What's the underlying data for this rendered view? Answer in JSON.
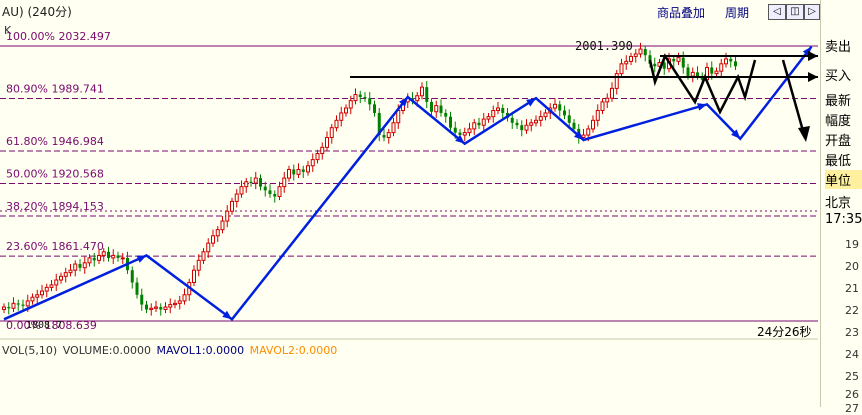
{
  "header": {
    "title": "AU)  (240分)",
    "subtitle": "K",
    "overlay_label": "商品叠加",
    "period_label": "周期"
  },
  "side": {
    "items": [
      "卖出",
      "买入",
      "最新",
      "幅度",
      "开盘",
      "最低",
      "单位",
      "北京",
      "17:35"
    ],
    "ticks": [
      "19",
      "20",
      "21",
      "22",
      "23",
      "24",
      "25",
      "26",
      "27"
    ]
  },
  "timer": "24分26秒",
  "volume": {
    "label": "VOL(5,10)",
    "volume": "VOLUME:0.0000",
    "mavol1": "MAVOL1:0.0000",
    "mavol2": "MAVOL2:0.0000",
    "mavol1_color": "#000080",
    "mavol2_color": "#ff8c00"
  },
  "chart_data": {
    "type": "candlestick",
    "high_annotation": "2001.390",
    "low_annotation": "1808.7",
    "fib_levels": [
      {
        "label": "100.00% 2032.497",
        "pct": 100.0,
        "price": 2032.497
      },
      {
        "label": "80.90% 1989.741",
        "pct": 80.9,
        "price": 1989.741
      },
      {
        "label": "61.80% 1946.984",
        "pct": 61.8,
        "price": 1946.984
      },
      {
        "label": "50.00% 1920.568",
        "pct": 50.0,
        "price": 1920.568
      },
      {
        "label": "38.20% 1894.153",
        "pct": 38.2,
        "price": 1894.153
      },
      {
        "label": "23.60% 1861.470",
        "pct": 23.6,
        "price": 1861.47
      },
      {
        "label": "0.00% 1808.639",
        "pct": 0.0,
        "price": 1808.639
      }
    ],
    "trend_path": [
      [
        0,
        1810
      ],
      [
        30,
        1862
      ],
      [
        48,
        1810
      ],
      [
        85,
        1991
      ],
      [
        97,
        1953
      ],
      [
        112,
        1990
      ],
      [
        122,
        1956
      ],
      [
        148,
        1985
      ],
      [
        155,
        1957
      ],
      [
        170,
        2032
      ]
    ],
    "closes": [
      1820,
      1819,
      1823,
      1822,
      1821,
      1825,
      1828,
      1830,
      1833,
      1836,
      1838,
      1842,
      1845,
      1848,
      1850,
      1855,
      1852,
      1856,
      1860,
      1858,
      1862,
      1865,
      1860,
      1862,
      1860,
      1860,
      1850,
      1840,
      1830,
      1822,
      1818,
      1819,
      1820,
      1818,
      1820,
      1822,
      1823,
      1825,
      1830,
      1840,
      1850,
      1858,
      1865,
      1872,
      1878,
      1883,
      1890,
      1898,
      1906,
      1912,
      1918,
      1922,
      1921,
      1925,
      1918,
      1915,
      1912,
      1910,
      1918,
      1925,
      1932,
      1928,
      1932,
      1930,
      1935,
      1940,
      1945,
      1950,
      1958,
      1966,
      1972,
      1978,
      1982,
      1988,
      1993,
      1991,
      1990,
      1985,
      1978,
      1960,
      1958,
      1962,
      1970,
      1980,
      1987,
      1990,
      1988,
      1992,
      1999,
      1987,
      1979,
      1984,
      1978,
      1975,
      1966,
      1962,
      1960,
      1962,
      1965,
      1970,
      1968,
      1973,
      1975,
      1980,
      1982,
      1978,
      1974,
      1970,
      1968,
      1964,
      1968,
      1970,
      1972,
      1975,
      1978,
      1982,
      1985,
      1980,
      1976,
      1970,
      1965,
      1958,
      1960,
      1965,
      1972,
      1980,
      1987,
      1990,
      1998,
      2010,
      2018,
      2020,
      2024,
      2026,
      2030,
      2025,
      2018,
      2016,
      2019,
      2014,
      2022,
      2020,
      2023,
      2015,
      2008,
      2011,
      2008,
      2005,
      2015,
      2010,
      2012,
      2018,
      2022,
      2020,
      2016
    ]
  }
}
